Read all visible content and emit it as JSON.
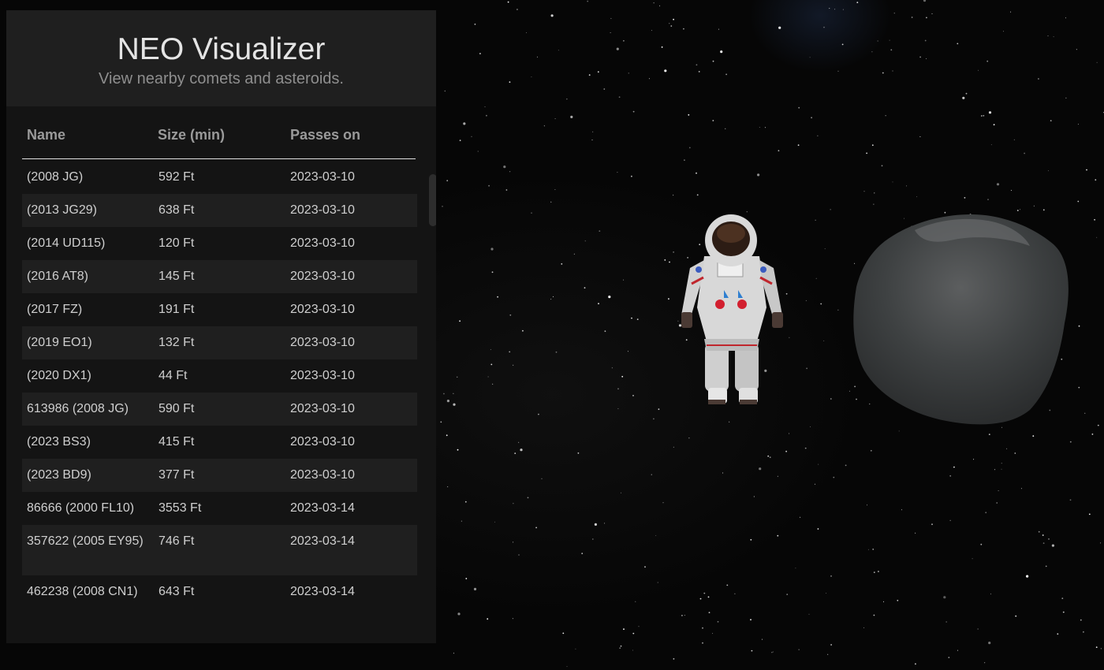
{
  "app": {
    "title": "NEO Visualizer",
    "subtitle": "View nearby comets and asteroids."
  },
  "table": {
    "columns": [
      "Name",
      "Size (min)",
      "Passes on"
    ],
    "rows": [
      {
        "name": "(2008 JG)",
        "size": "592 Ft",
        "date": "2023-03-10"
      },
      {
        "name": "(2013 JG29)",
        "size": "638 Ft",
        "date": "2023-03-10"
      },
      {
        "name": "(2014 UD115)",
        "size": "120 Ft",
        "date": "2023-03-10"
      },
      {
        "name": "(2016 AT8)",
        "size": "145 Ft",
        "date": "2023-03-10"
      },
      {
        "name": "(2017 FZ)",
        "size": "191 Ft",
        "date": "2023-03-10"
      },
      {
        "name": "(2019 EO1)",
        "size": "132 Ft",
        "date": "2023-03-10"
      },
      {
        "name": "(2020 DX1)",
        "size": "44 Ft",
        "date": "2023-03-10"
      },
      {
        "name": "613986 (2008 JG)",
        "size": "590 Ft",
        "date": "2023-03-10"
      },
      {
        "name": "(2023 BS3)",
        "size": "415 Ft",
        "date": "2023-03-10"
      },
      {
        "name": "(2023 BD9)",
        "size": "377 Ft",
        "date": "2023-03-10"
      },
      {
        "name": "86666 (2000 FL10)",
        "size": "3553 Ft",
        "date": "2023-03-14"
      },
      {
        "name": "357622 (2005 EY95)",
        "size": "746 Ft",
        "date": "2023-03-14"
      },
      {
        "name": "462238 (2008 CN1)",
        "size": "643 Ft",
        "date": "2023-03-14"
      }
    ]
  },
  "colors": {
    "background": "#060606",
    "panel": "#141414",
    "panel_header": "#1f1f1f",
    "row_alt": "#1f1f1f"
  },
  "scene": {
    "objects": [
      "astronaut-model",
      "asteroid-model",
      "starfield"
    ]
  }
}
